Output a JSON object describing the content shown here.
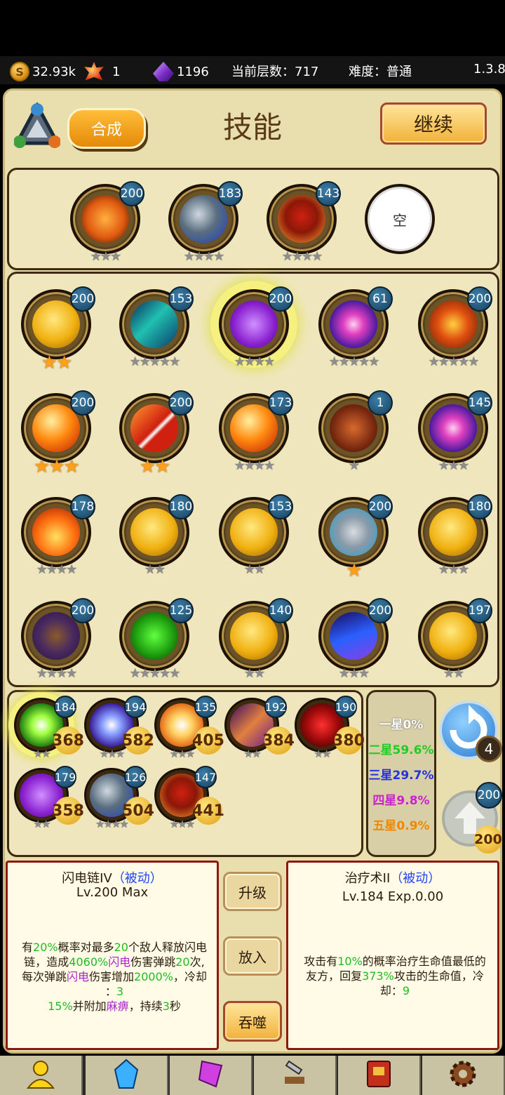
{
  "currency": {
    "gold": "32.93k",
    "ember": "1",
    "crystal": "1196",
    "floor_label": "当前层数：717",
    "difficulty_label": "难度：普通",
    "version": "1.3.8"
  },
  "header": {
    "merge_label": "合成",
    "title": "技能",
    "continue_label": "继续"
  },
  "equipped": [
    {
      "icon": "holy-cross-icon",
      "level": "200",
      "stars": 3
    },
    {
      "icon": "rock-storm-icon",
      "level": "183",
      "stars": 4
    },
    {
      "icon": "fire-body-icon",
      "level": "143",
      "stars": 4
    },
    {
      "empty_label": "空"
    }
  ],
  "grid": [
    {
      "icon": "golden-scroll-icon",
      "level": "200",
      "stars": 2,
      "gold": true
    },
    {
      "icon": "wind-slash-icon",
      "level": "153",
      "stars": 5
    },
    {
      "icon": "lightning-chain-icon",
      "level": "200",
      "stars": 4,
      "selected": true
    },
    {
      "icon": "arcane-orb-icon",
      "level": "61",
      "stars": 5
    },
    {
      "icon": "lava-icon",
      "level": "200",
      "stars": 5
    },
    {
      "icon": "meteor-icon",
      "level": "200",
      "stars": 3,
      "gold": true
    },
    {
      "icon": "berserk-icon",
      "level": "200",
      "stars": 2,
      "gold": true
    },
    {
      "icon": "meteor-icon",
      "level": "173",
      "stars": 4
    },
    {
      "icon": "bronze-shield-icon",
      "level": "1",
      "stars": 1
    },
    {
      "icon": "arcane-orb-icon",
      "level": "145",
      "stars": 3
    },
    {
      "icon": "flame-icon",
      "level": "178",
      "stars": 4
    },
    {
      "icon": "golden-scroll-icon",
      "level": "180",
      "stars": 2
    },
    {
      "icon": "golden-scroll-icon",
      "level": "153",
      "stars": 2
    },
    {
      "icon": "stone-armor-icon",
      "level": "200",
      "stars": 1,
      "gold": true
    },
    {
      "icon": "golden-scroll-icon",
      "level": "180",
      "stars": 3
    },
    {
      "icon": "poison-cloud-icon",
      "level": "200",
      "stars": 4
    },
    {
      "icon": "skull-icon",
      "level": "125",
      "stars": 5
    },
    {
      "icon": "golden-scroll-icon",
      "level": "140",
      "stars": 2
    },
    {
      "icon": "blue-wave-icon",
      "level": "200",
      "stars": 3
    },
    {
      "icon": "golden-scroll-icon",
      "level": "197",
      "stars": 2
    }
  ],
  "inventory": [
    {
      "icon": "heal-burst-icon",
      "level": "184",
      "count": "368",
      "stars": 2,
      "selected": true
    },
    {
      "icon": "blue-lightning-icon",
      "level": "194",
      "count": "582",
      "stars": 3
    },
    {
      "icon": "sun-burst-icon",
      "level": "135",
      "count": "405",
      "stars": 3
    },
    {
      "icon": "purple-meteor-icon",
      "level": "192",
      "count": "384",
      "stars": 2
    },
    {
      "icon": "blood-rune-icon",
      "level": "190",
      "count": "380",
      "stars": 2
    },
    {
      "icon": "lightning-chain-icon",
      "level": "179",
      "count": "358",
      "stars": 2
    },
    {
      "icon": "rock-storm-icon",
      "level": "126",
      "count": "504",
      "stars": 4
    },
    {
      "icon": "fire-body-icon",
      "level": "147",
      "count": "441",
      "stars": 3
    }
  ],
  "rates": [
    {
      "label": "一星0%",
      "color": "#ffffff"
    },
    {
      "label": "二星59.6%",
      "color": "#22cc22"
    },
    {
      "label": "三星29.7%",
      "color": "#2233dd"
    },
    {
      "label": "四星9.8%",
      "color": "#cc22cc"
    },
    {
      "label": "五星0.9%",
      "color": "#ee8800"
    }
  ],
  "refresh": {
    "count": "4"
  },
  "upgrade_side": {
    "cost_top": "200",
    "cost_bottom": "200"
  },
  "left_info": {
    "name": "闪电链IV",
    "type": "（被动）",
    "level": "Lv.200 Max",
    "desc": [
      [
        [
          "t",
          "有"
        ],
        [
          "g",
          "20%"
        ],
        [
          "t",
          "概率对最多"
        ],
        [
          "g",
          "20"
        ],
        [
          "t",
          "个敌人释放闪电"
        ]
      ],
      [
        [
          "t",
          "链，造成"
        ],
        [
          "g",
          "4060%"
        ],
        [
          "p",
          "闪电"
        ],
        [
          "t",
          "伤害弹跳"
        ],
        [
          "g",
          "20"
        ],
        [
          "t",
          "次,"
        ]
      ],
      [
        [
          "t",
          "每次弹跳"
        ],
        [
          "p",
          "闪电"
        ],
        [
          "t",
          "伤害增加"
        ],
        [
          "g",
          "2000%"
        ],
        [
          "t",
          "，冷却"
        ]
      ],
      [
        [
          "t",
          "："
        ],
        [
          "g",
          "3"
        ]
      ],
      [
        [
          "g",
          "15%"
        ],
        [
          "t",
          "并附加"
        ],
        [
          "p",
          "麻痹"
        ],
        [
          "t",
          "，持续"
        ],
        [
          "g",
          "3"
        ],
        [
          "t",
          "秒"
        ]
      ]
    ]
  },
  "actions": {
    "upgrade": "升级",
    "place": "放入",
    "devour": "吞噬"
  },
  "right_info": {
    "name": "治疗术II",
    "type": "（被动）",
    "level": "Lv.184 Exp.0.00",
    "desc": [
      [
        [
          "t",
          "攻击有"
        ],
        [
          "g",
          "10%"
        ],
        [
          "t",
          "的概率治疗生命值最低的"
        ]
      ],
      [
        [
          "t",
          "友方，回复"
        ],
        [
          "g",
          "373%"
        ],
        [
          "t",
          "攻击的生命值，冷"
        ]
      ],
      [
        [
          "t",
          "却："
        ],
        [
          "g",
          "9"
        ]
      ]
    ]
  },
  "colors": {
    "green": "#22bb22",
    "purple": "#aa22cc",
    "blue": "#2244ee",
    "gold_star": "#ffa018"
  },
  "tabs": [
    {
      "icon": "hero-icon"
    },
    {
      "icon": "crystal-icon"
    },
    {
      "icon": "rune-icon"
    },
    {
      "icon": "forge-icon"
    },
    {
      "icon": "book-icon"
    },
    {
      "icon": "settings-gear-icon"
    }
  ]
}
